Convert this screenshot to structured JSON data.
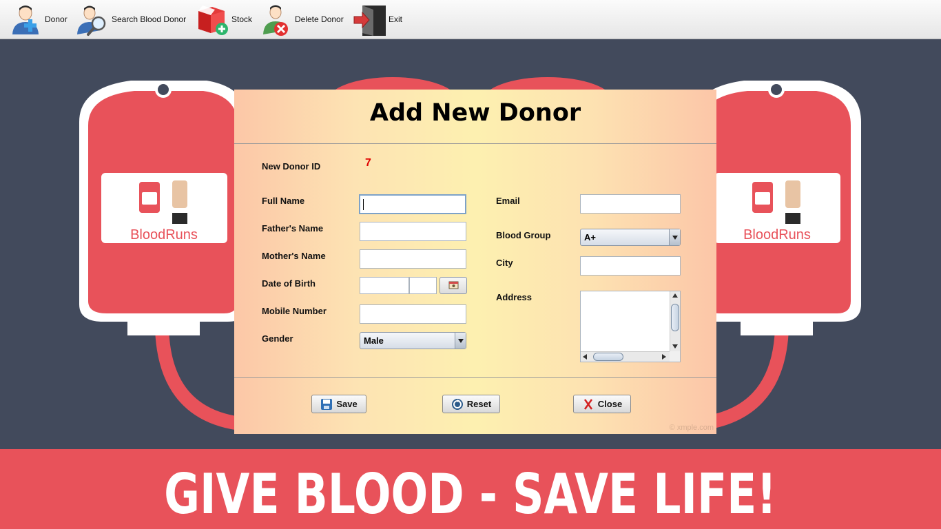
{
  "toolbar": {
    "items": [
      {
        "label": "Donor",
        "icon": "add-donor-icon"
      },
      {
        "label": "Search Blood Donor",
        "icon": "search-donor-icon"
      },
      {
        "label": "Stock",
        "icon": "stock-add-icon"
      },
      {
        "label": "Delete Donor",
        "icon": "delete-donor-icon"
      },
      {
        "label": "Exit",
        "icon": "exit-door-icon"
      }
    ]
  },
  "background": {
    "bag_logo_text": "BloodRuns",
    "banner_text": "GIVE BLOOD - SAVE LIFE!"
  },
  "dialog": {
    "title": "Add New Donor",
    "donor_id_label": "New Donor ID",
    "donor_id_value": "7",
    "full_name_label": "Full Name",
    "full_name_value": "",
    "fathers_name_label": "Father's Name",
    "fathers_name_value": "",
    "mothers_name_label": "Mother's Name",
    "mothers_name_value": "",
    "dob_label": "Date of Birth",
    "mobile_label": "Mobile Number",
    "mobile_value": "",
    "gender_label": "Gender",
    "gender_value": "Male",
    "email_label": "Email",
    "email_value": "",
    "blood_group_label": "Blood Group",
    "blood_group_value": "A+",
    "city_label": "City",
    "city_value": "",
    "address_label": "Address",
    "address_value": "",
    "buttons": {
      "save": "Save",
      "reset": "Reset",
      "close": "Close"
    },
    "watermark": "© xmple.com"
  },
  "colors": {
    "background": "#424a5c",
    "blood_red": "#e8525a",
    "id_value": "#e00000"
  }
}
